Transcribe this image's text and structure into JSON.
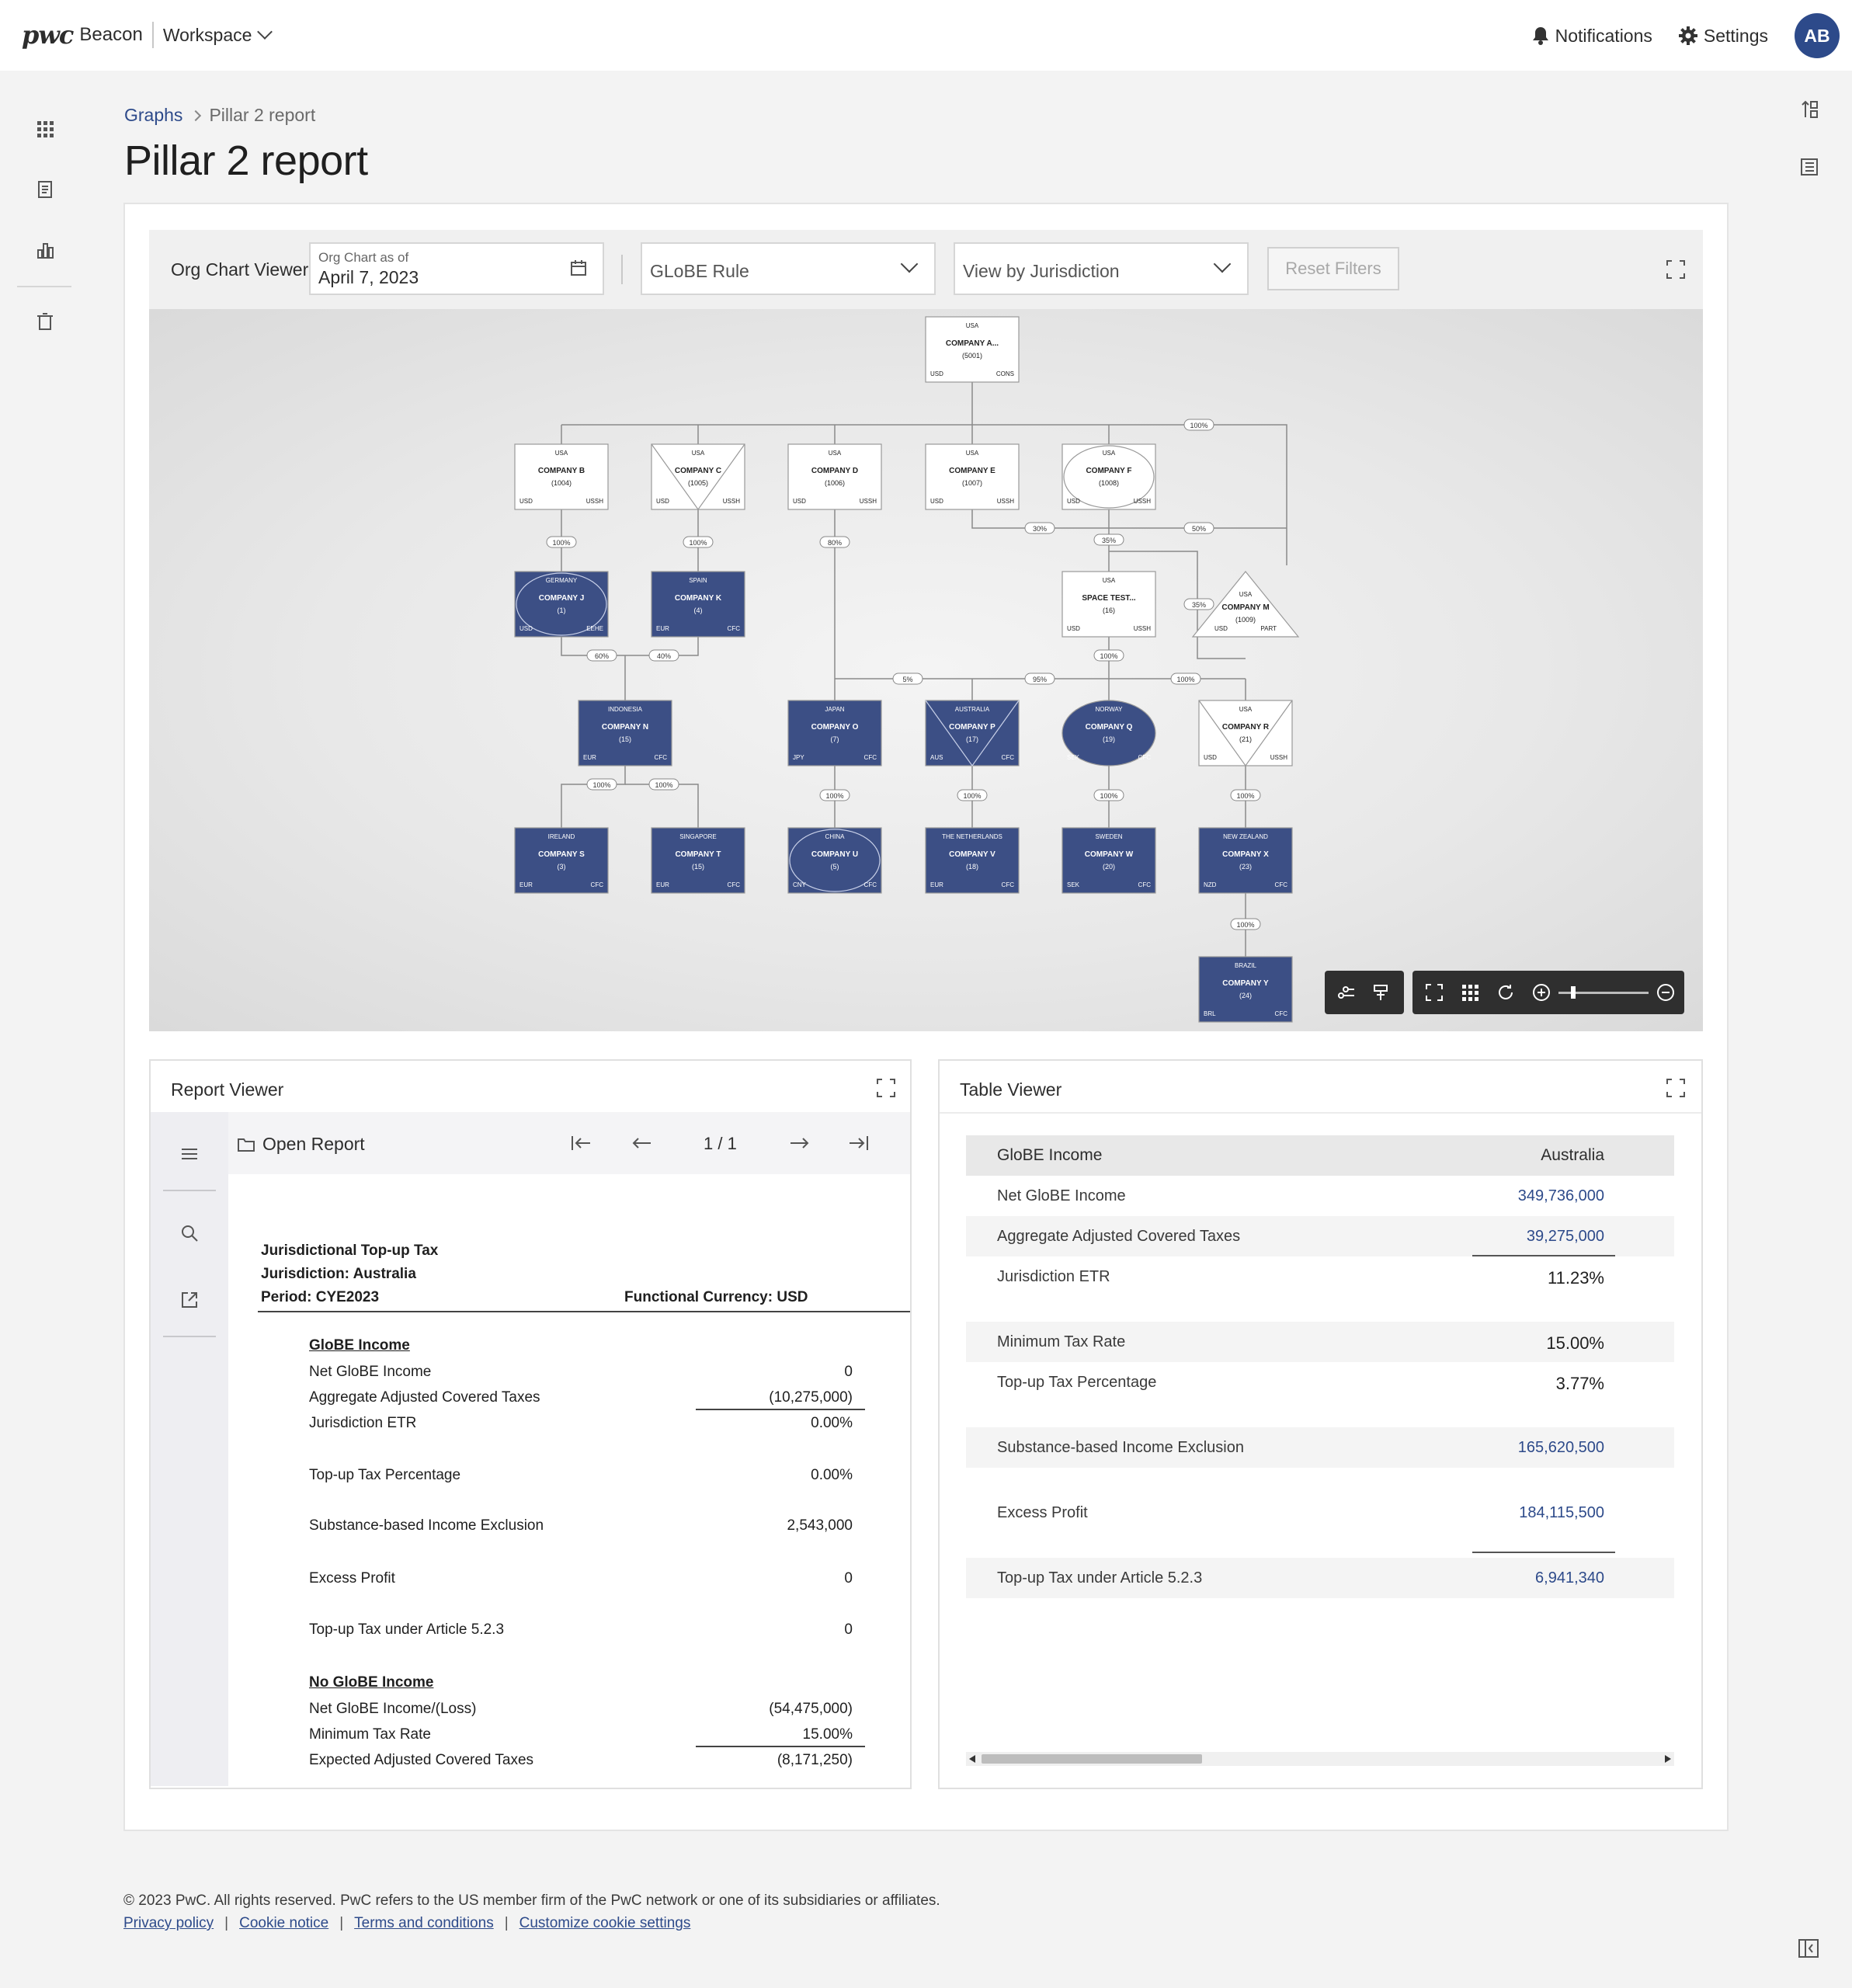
{
  "header": {
    "brand_logo": "pwc",
    "brand_name": "Beacon",
    "workspace": "Workspace",
    "notifications": "Notifications",
    "settings": "Settings",
    "avatar": "AB"
  },
  "breadcrumb": {
    "parent": "Graphs",
    "current": "Pillar 2 report"
  },
  "page_title": "Pillar 2 report",
  "org_viewer": {
    "title": "Org Chart Viewer",
    "date_label": "Org Chart as of",
    "date_value": "April 7, 2023",
    "rule_select": "GLoBE Rule",
    "view_select": "View by Jurisdiction",
    "reset_label": "Reset Filters",
    "nodes": [
      {
        "id": "a",
        "jur": "USA",
        "name": "COMPANY A...",
        "code": "(5001)",
        "cur": "USD",
        "tag": "CONS",
        "shape": "rect",
        "fill": "light"
      },
      {
        "id": "b",
        "jur": "USA",
        "name": "COMPANY B",
        "code": "(1004)",
        "cur": "USD",
        "tag": "USSH",
        "shape": "rect",
        "fill": "light"
      },
      {
        "id": "c",
        "jur": "USA",
        "name": "COMPANY C",
        "code": "(1005)",
        "cur": "USD",
        "tag": "USSH",
        "shape": "tri",
        "fill": "light"
      },
      {
        "id": "d",
        "jur": "USA",
        "name": "COMPANY D",
        "code": "(1006)",
        "cur": "USD",
        "tag": "USSH",
        "shape": "rect",
        "fill": "light"
      },
      {
        "id": "e",
        "jur": "USA",
        "name": "COMPANY E",
        "code": "(1007)",
        "cur": "USD",
        "tag": "USSH",
        "shape": "rect",
        "fill": "light"
      },
      {
        "id": "f",
        "jur": "USA",
        "name": "COMPANY F",
        "code": "(1008)",
        "cur": "USD",
        "tag": "USSH",
        "shape": "ellipse",
        "fill": "light"
      },
      {
        "id": "j",
        "jur": "GERMANY",
        "name": "COMPANY J",
        "code": "(1)",
        "cur": "USD",
        "tag": "EEHE",
        "shape": "ellipse",
        "fill": "dark"
      },
      {
        "id": "k",
        "jur": "SPAIN",
        "name": "COMPANY K",
        "code": "(4)",
        "cur": "EUR",
        "tag": "CFC",
        "shape": "rect",
        "fill": "dark"
      },
      {
        "id": "space",
        "jur": "USA",
        "name": "SPACE TEST...",
        "code": "(16)",
        "cur": "USD",
        "tag": "USSH",
        "shape": "rect",
        "fill": "light"
      },
      {
        "id": "m",
        "jur": "USA",
        "name": "COMPANY M",
        "code": "(1009)",
        "cur": "USD",
        "tag": "PART",
        "shape": "triangle",
        "fill": "light"
      },
      {
        "id": "n",
        "jur": "INDONESIA",
        "name": "COMPANY N",
        "code": "(15)",
        "cur": "EUR",
        "tag": "CFC",
        "shape": "rect",
        "fill": "dark"
      },
      {
        "id": "o",
        "jur": "JAPAN",
        "name": "COMPANY O",
        "code": "(7)",
        "cur": "JPY",
        "tag": "CFC",
        "shape": "rect",
        "fill": "dark"
      },
      {
        "id": "p",
        "jur": "AUSTRALIA",
        "name": "COMPANY P",
        "code": "(17)",
        "cur": "AUS",
        "tag": "CFC",
        "shape": "tri",
        "fill": "dark"
      },
      {
        "id": "q",
        "jur": "NORWAY",
        "name": "COMPANY Q",
        "code": "(19)",
        "cur": "SEK",
        "tag": "CFC",
        "shape": "oval",
        "fill": "dark"
      },
      {
        "id": "r",
        "jur": "USA",
        "name": "COMPANY R",
        "code": "(21)",
        "cur": "USD",
        "tag": "USSH",
        "shape": "tri",
        "fill": "light"
      },
      {
        "id": "s",
        "jur": "IRELAND",
        "name": "COMPANY S",
        "code": "(3)",
        "cur": "EUR",
        "tag": "CFC",
        "shape": "rect",
        "fill": "dark"
      },
      {
        "id": "t",
        "jur": "SINGAPORE",
        "name": "COMPANY T",
        "code": "(15)",
        "cur": "EUR",
        "tag": "CFC",
        "shape": "rect",
        "fill": "dark"
      },
      {
        "id": "u",
        "jur": "CHINA",
        "name": "COMPANY U",
        "code": "(5)",
        "cur": "CNY",
        "tag": "CFC",
        "shape": "ellipse",
        "fill": "dark"
      },
      {
        "id": "v",
        "jur": "THE NETHERLANDS",
        "name": "COMPANY V",
        "code": "(18)",
        "cur": "EUR",
        "tag": "CFC",
        "shape": "rect",
        "fill": "dark"
      },
      {
        "id": "w",
        "jur": "SWEDEN",
        "name": "COMPANY W",
        "code": "(20)",
        "cur": "SEK",
        "tag": "CFC",
        "shape": "rect",
        "fill": "dark"
      },
      {
        "id": "x",
        "jur": "NEW ZEALAND",
        "name": "COMPANY X",
        "code": "(23)",
        "cur": "NZD",
        "tag": "CFC",
        "shape": "rect",
        "fill": "dark"
      },
      {
        "id": "y",
        "jur": "BRAZIL",
        "name": "COMPANY Y",
        "code": "(24)",
        "cur": "BRL",
        "tag": "CFC",
        "shape": "rect",
        "fill": "dark"
      }
    ],
    "edge_labels": [
      "100%",
      "100%",
      "100%",
      "80%",
      "30%",
      "35%",
      "50%",
      "35%",
      "60%",
      "40%",
      "100%",
      "5%",
      "95%",
      "100%",
      "100%",
      "100%",
      "100%",
      "100%",
      "100%",
      "100%",
      "100%"
    ]
  },
  "report_viewer": {
    "title": "Report Viewer",
    "open_report": "Open Report",
    "page_indicator": "1 / 1",
    "doc": {
      "h1": "Jurisdictional Top-up Tax",
      "h2": "Jurisdiction: Australia",
      "h3": "Period: CYE2023",
      "currency": "Functional Currency: USD",
      "section1": "GloBE Income",
      "rows1": [
        {
          "label": "Net GloBE Income",
          "value": "0"
        },
        {
          "label": "Aggregate Adjusted Covered Taxes",
          "value": "(10,275,000)"
        },
        {
          "label": "Jurisdiction ETR",
          "value": "0.00%"
        },
        {
          "label": "Top-up Tax Percentage",
          "value": "0.00%"
        },
        {
          "label": "Substance-based Income Exclusion",
          "value": "2,543,000"
        },
        {
          "label": "Excess Profit",
          "value": "0"
        },
        {
          "label": "Top-up Tax under Article 5.2.3",
          "value": "0"
        }
      ],
      "section2": "No GloBE Income",
      "rows2": [
        {
          "label": "Net GloBE Income/(Loss)",
          "value": "(54,475,000)"
        },
        {
          "label": "Minimum Tax Rate",
          "value": "15.00%"
        },
        {
          "label": "Expected Adjusted Covered Taxes",
          "value": "(8,171,250)"
        }
      ]
    }
  },
  "table_viewer": {
    "title": "Table Viewer",
    "head_label": "GloBE Income",
    "head_value": "Australia",
    "rows": [
      {
        "label": "Net GloBE Income",
        "value": "349,736,000"
      },
      {
        "label": "Aggregate Adjusted Covered Taxes",
        "value": "39,275,000"
      },
      {
        "label": "Jurisdiction ETR",
        "value": "11.23%"
      },
      {
        "label": "Minimum Tax Rate",
        "value": "15.00%"
      },
      {
        "label": "Top-up Tax Percentage",
        "value": "3.77%"
      },
      {
        "label": "Substance-based Income Exclusion",
        "value": "165,620,500"
      },
      {
        "label": "Excess Profit",
        "value": "184,115,500"
      },
      {
        "label": "Top-up Tax under Article 5.2.3",
        "value": "6,941,340"
      }
    ]
  },
  "footer": {
    "copyright": "© 2023 PwC. All rights reserved. PwC refers to the US member firm of the PwC network or one of its subsidiaries or affiliates.",
    "links": [
      "Privacy policy",
      "Cookie notice",
      "Terms and conditions",
      "Customize cookie settings"
    ]
  },
  "colors": {
    "accent": "#2d4a8a",
    "node_dark": "#3c4f85",
    "node_light": "#ffffff"
  }
}
